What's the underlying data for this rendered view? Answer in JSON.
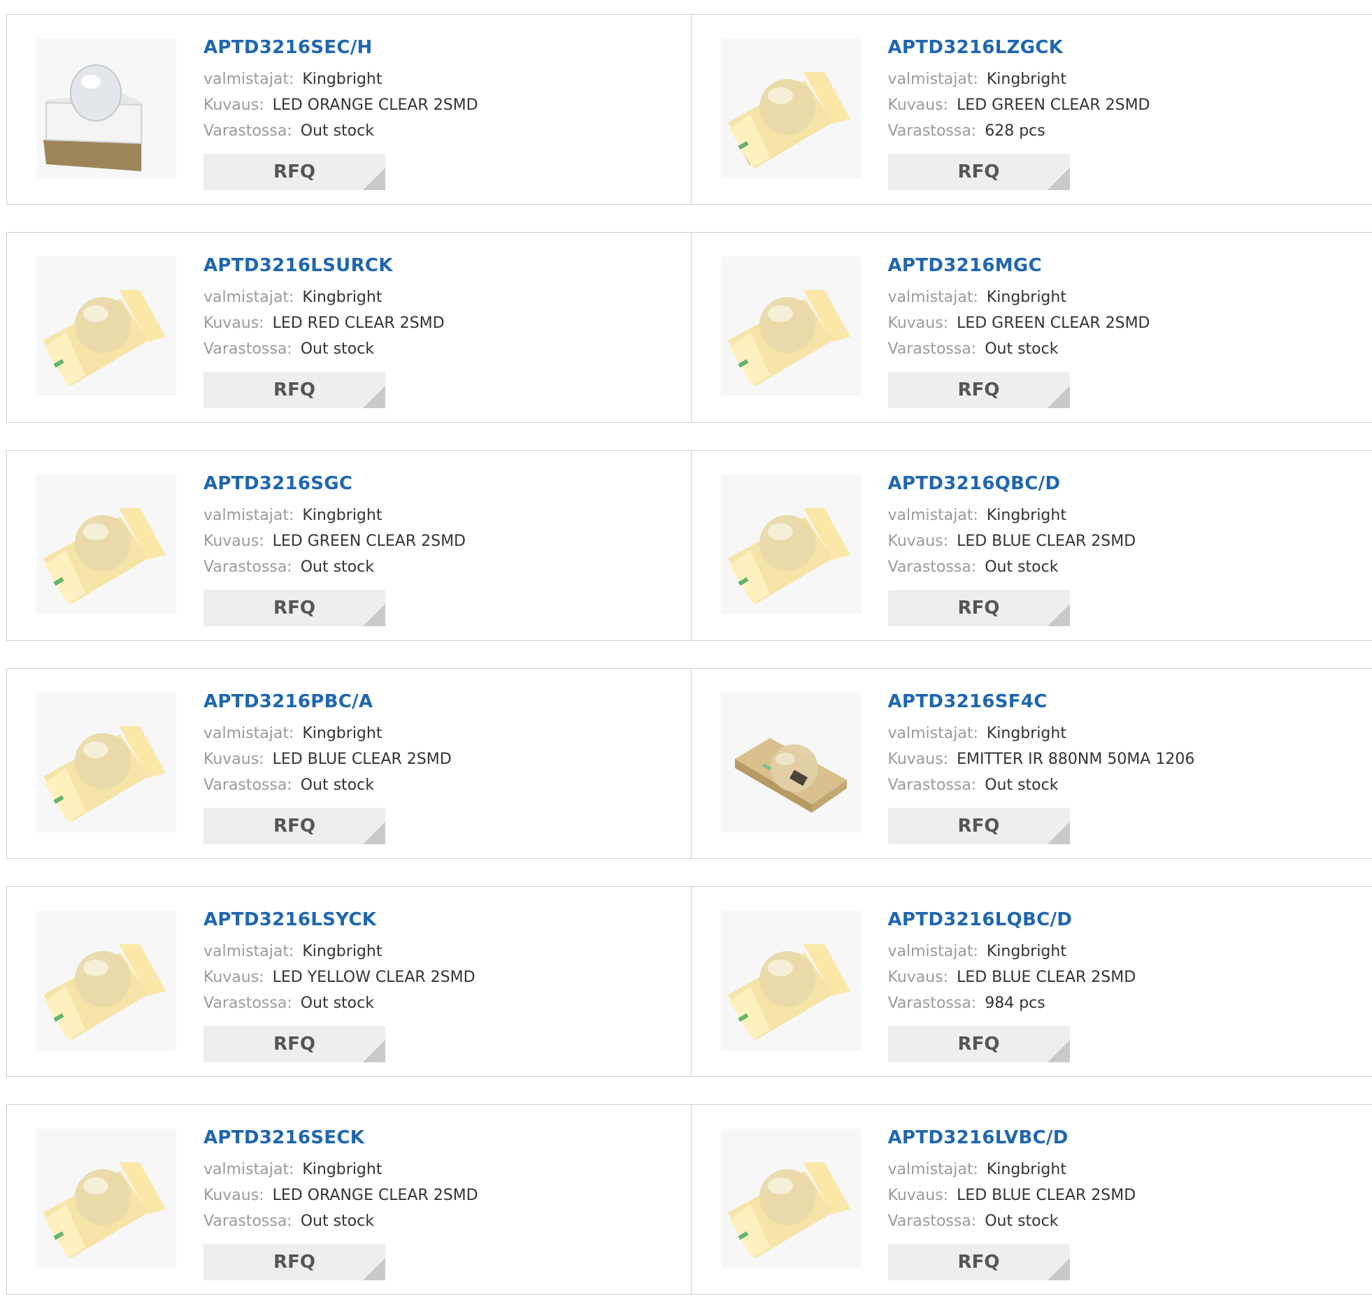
{
  "labels": {
    "manufacturer": "valmistajat:",
    "description": "Kuvaus:",
    "stock": "Varastossa:",
    "rfq": "RFQ"
  },
  "colors": {
    "part_link": "#1f66b0",
    "label_grey": "#9a9a9a",
    "value_dark": "#333333",
    "button_bg": "#eeeeee",
    "border": "#cfcfcf"
  },
  "products": [
    {
      "part": "APTD3216SEC/H",
      "manufacturer": "Kingbright",
      "description": "LED ORANGE CLEAR 2SMD",
      "stock": "Out stock",
      "image": "led-clear-dome-icon"
    },
    {
      "part": "APTD3216LZGCK",
      "manufacturer": "Kingbright",
      "description": "LED GREEN CLEAR 2SMD",
      "stock": "628 pcs",
      "image": "led-yellow-smd-icon"
    },
    {
      "part": "APTD3216LSURCK",
      "manufacturer": "Kingbright",
      "description": "LED RED CLEAR 2SMD",
      "stock": "Out stock",
      "image": "led-yellow-smd-icon"
    },
    {
      "part": "APTD3216MGC",
      "manufacturer": "Kingbright",
      "description": "LED GREEN CLEAR 2SMD",
      "stock": "Out stock",
      "image": "led-yellow-smd-icon"
    },
    {
      "part": "APTD3216SGC",
      "manufacturer": "Kingbright",
      "description": "LED GREEN CLEAR 2SMD",
      "stock": "Out stock",
      "image": "led-yellow-smd-icon"
    },
    {
      "part": "APTD3216QBC/D",
      "manufacturer": "Kingbright",
      "description": "LED BLUE CLEAR 2SMD",
      "stock": "Out stock",
      "image": "led-yellow-smd-icon"
    },
    {
      "part": "APTD3216PBC/A",
      "manufacturer": "Kingbright",
      "description": "LED BLUE CLEAR 2SMD",
      "stock": "Out stock",
      "image": "led-yellow-smd-icon"
    },
    {
      "part": "APTD3216SF4C",
      "manufacturer": "Kingbright",
      "description": "EMITTER IR 880NM 50MA 1206",
      "stock": "Out stock",
      "image": "ir-emitter-smd-icon"
    },
    {
      "part": "APTD3216LSYCK",
      "manufacturer": "Kingbright",
      "description": "LED YELLOW CLEAR 2SMD",
      "stock": "Out stock",
      "image": "led-yellow-smd-icon"
    },
    {
      "part": "APTD3216LQBC/D",
      "manufacturer": "Kingbright",
      "description": "LED BLUE CLEAR 2SMD",
      "stock": "984 pcs",
      "image": "led-yellow-smd-icon"
    },
    {
      "part": "APTD3216SECK",
      "manufacturer": "Kingbright",
      "description": "LED ORANGE CLEAR 2SMD",
      "stock": "Out stock",
      "image": "led-yellow-smd-icon"
    },
    {
      "part": "APTD3216LVBC/D",
      "manufacturer": "Kingbright",
      "description": "LED BLUE CLEAR 2SMD",
      "stock": "Out stock",
      "image": "led-yellow-smd-icon"
    }
  ]
}
